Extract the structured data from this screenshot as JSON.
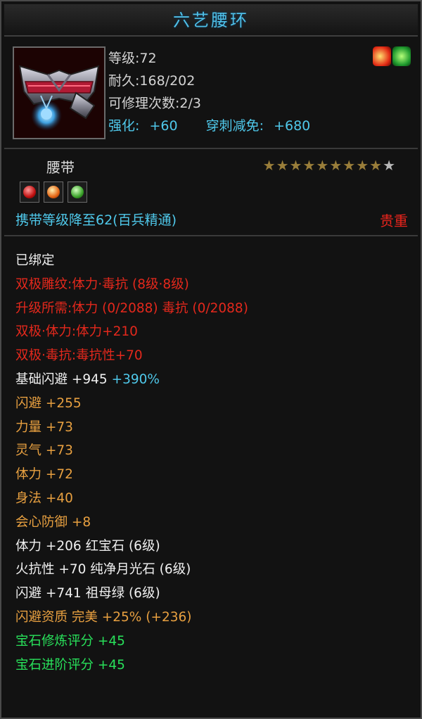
{
  "item_name": "六艺腰环",
  "icon_name": "belt-item-icon",
  "header_stats": {
    "level": "等级:72",
    "durability": "耐久:168/202",
    "repair_times": "可修理次数:2/3",
    "enhance_label": "强化:",
    "enhance_value": "+60",
    "pierce_label": "穿刺减免:",
    "pierce_value": "+680"
  },
  "item_type": "腰带",
  "stars": {
    "filled": 9,
    "total": 10
  },
  "sockets": [
    "red-gem-icon",
    "orange-gem-icon",
    "green-gem-icon"
  ],
  "carry_requirement": "携带等级降至62(百兵精通)",
  "rarity": "贵重",
  "colors": {
    "title": "#4fc0e8",
    "white": "#f0f0f0",
    "red": "#e3281c",
    "orange": "#e8a040",
    "green": "#28e05a",
    "blue": "#4fc8ea"
  },
  "attributes": [
    {
      "parts": [
        {
          "text": "已绑定",
          "color": "white"
        }
      ]
    },
    {
      "parts": [
        {
          "text": "双极雕纹:体力·毒抗 (8级·8级)",
          "color": "red"
        }
      ]
    },
    {
      "parts": [
        {
          "text": "升级所需:体力 (0/2088)  毒抗 (0/2088)",
          "color": "red"
        }
      ]
    },
    {
      "parts": [
        {
          "text": "双极·体力:体力+210",
          "color": "red"
        }
      ]
    },
    {
      "parts": [
        {
          "text": "双极·毒抗:毒抗性+70",
          "color": "red"
        }
      ]
    },
    {
      "parts": [
        {
          "text": "基础闪避 +945 ",
          "color": "white"
        },
        {
          "text": "+390%",
          "color": "blue"
        }
      ]
    },
    {
      "parts": [
        {
          "text": "闪避 +255",
          "color": "orange"
        }
      ]
    },
    {
      "parts": [
        {
          "text": "力量 +73",
          "color": "orange"
        }
      ]
    },
    {
      "parts": [
        {
          "text": "灵气 +73",
          "color": "orange"
        }
      ]
    },
    {
      "parts": [
        {
          "text": "体力 +72",
          "color": "orange"
        }
      ]
    },
    {
      "parts": [
        {
          "text": "身法 +40",
          "color": "orange"
        }
      ]
    },
    {
      "parts": [
        {
          "text": "会心防御 +8",
          "color": "orange"
        }
      ]
    },
    {
      "parts": [
        {
          "text": "体力 +206 红宝石 (6级)",
          "color": "white"
        }
      ]
    },
    {
      "parts": [
        {
          "text": "火抗性 +70 纯净月光石 (6级)",
          "color": "white"
        }
      ]
    },
    {
      "parts": [
        {
          "text": "闪避 +741 祖母绿 (6级)",
          "color": "white"
        }
      ]
    },
    {
      "parts": [
        {
          "text": "闪避资质  完美 +25% (+236)",
          "color": "orange"
        }
      ]
    },
    {
      "parts": [
        {
          "text": "宝石修炼评分 +45",
          "color": "green"
        }
      ]
    },
    {
      "parts": [
        {
          "text": "宝石进阶评分 +45",
          "color": "green"
        }
      ]
    }
  ]
}
